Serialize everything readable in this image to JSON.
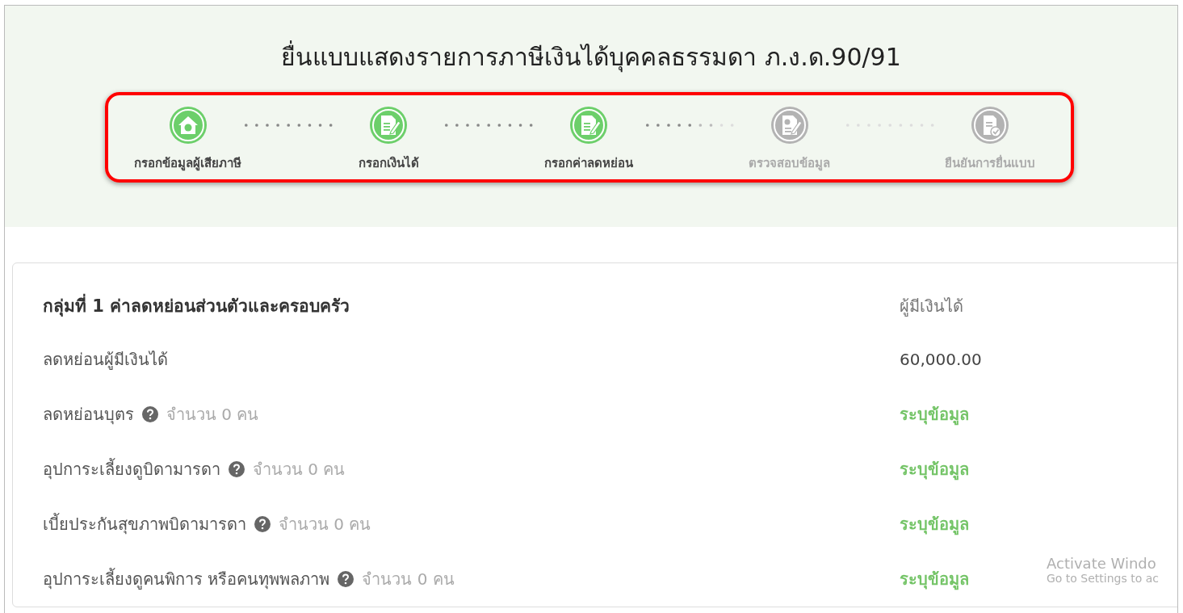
{
  "title": "ยื่นแบบแสดงรายการภาษีเงินได้บุคคลธรรมดา ภ.ง.ด.90/91",
  "steps": [
    {
      "label": "กรอกข้อมูลผู้เสียภาษี",
      "kind": "house",
      "completed": true
    },
    {
      "label": "กรอกเงินได้",
      "kind": "document",
      "completed": true
    },
    {
      "label": "กรอกค่าลดหย่อน",
      "kind": "document",
      "completed": true
    },
    {
      "label": "ตรวจสอบข้อมูล",
      "kind": "invoice",
      "completed": false
    },
    {
      "label": "ยืนยันการยื่นแบบ",
      "kind": "confirm",
      "completed": false
    }
  ],
  "section": {
    "heading": "กลุ่มที่ 1 ค่าลดหย่อนส่วนตัวและครอบครัว",
    "column_header": "ผู้มีเงินได้",
    "rows": [
      {
        "label": "ลดหย่อนผู้มีเงินได้",
        "value": "60,000.00",
        "kind": "amount"
      },
      {
        "label": "ลดหย่อนบุตร",
        "count": "จำนวน 0 คน",
        "value": "ระบุข้อมูล",
        "kind": "link"
      },
      {
        "label": "อุปการะเลี้ยงดูบิดามารดา",
        "count": "จำนวน 0 คน",
        "value": "ระบุข้อมูล",
        "kind": "link"
      },
      {
        "label": "เบี้ยประกันสุขภาพบิดามารดา",
        "count": "จำนวน 0 คน",
        "value": "ระบุข้อมูล",
        "kind": "link"
      },
      {
        "label": "อุปการะเลี้ยงดูคนพิการ หรือคนทุพพลภาพ",
        "count": "จำนวน 0 คน",
        "value": "ระบุข้อมูล",
        "kind": "link"
      }
    ]
  },
  "os_notice": {
    "title": "Activate Windo",
    "subtitle": "Go to Settings to ac"
  }
}
